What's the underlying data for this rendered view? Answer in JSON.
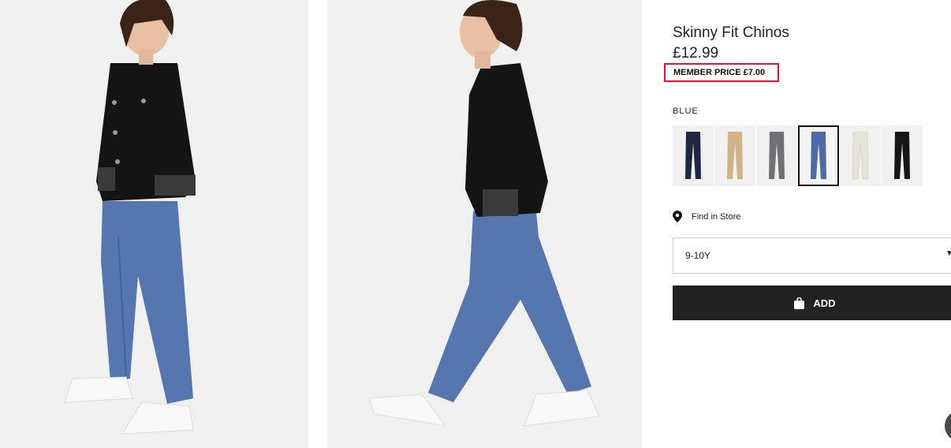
{
  "product": {
    "title": "Skinny Fit Chinos",
    "price": "£12.99",
    "member_price": "MEMBER PRICE £7.00",
    "member_price_highlight_color": "#e2162a"
  },
  "color": {
    "label": "BLUE",
    "swatches": [
      {
        "name": "navy",
        "color": "#1e2740"
      },
      {
        "name": "beige",
        "color": "#d2b387"
      },
      {
        "name": "grey",
        "color": "#717074"
      },
      {
        "name": "blue",
        "color": "#4b6aa6",
        "selected": true
      },
      {
        "name": "cream",
        "color": "#e6e4d8"
      },
      {
        "name": "black",
        "color": "#161616"
      }
    ]
  },
  "store": {
    "label": "Find in Store",
    "icon": "location-pin-icon"
  },
  "size": {
    "value": "9-10Y",
    "icon": "chevron-down-icon"
  },
  "cart": {
    "add_label": "ADD",
    "icon": "shopping-bag-icon"
  },
  "colors": {
    "button_bg": "#222222",
    "accent": "#e2162a"
  }
}
